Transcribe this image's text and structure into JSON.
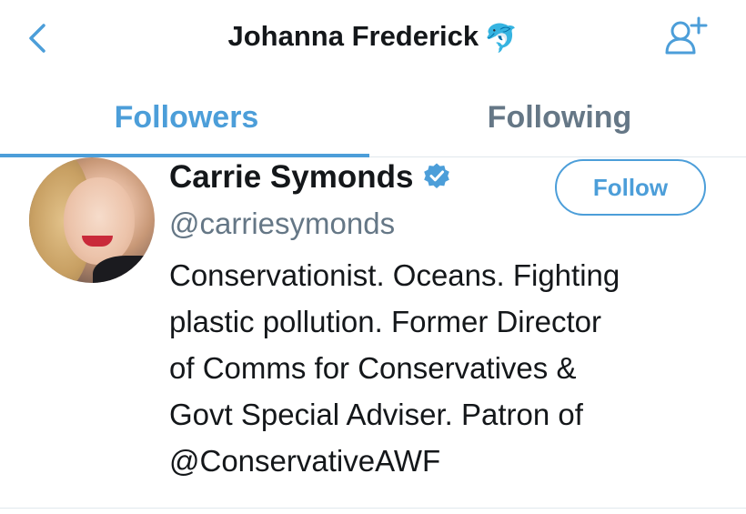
{
  "header": {
    "title": "Johanna Frederick",
    "title_emoji": "🐬",
    "back_icon": "chevron-left-icon",
    "add_user_icon": "add-user-icon"
  },
  "tabs": [
    {
      "label": "Followers",
      "active": true
    },
    {
      "label": "Following",
      "active": false
    }
  ],
  "follower": {
    "name": "Carrie Symonds",
    "verified": true,
    "handle": "@carriesymonds",
    "bio_lines": [
      "Conservationist. Oceans. Fighting",
      "plastic pollution. Former Director",
      "of Comms for Conservatives &",
      "Govt Special Adviser. Patron of",
      "@ConservativeAWF"
    ],
    "follow_label": "Follow"
  },
  "colors": {
    "accent": "#4c9ed9",
    "text_primary": "#14171a",
    "text_secondary": "#657786",
    "divider": "#e1e8ed"
  }
}
